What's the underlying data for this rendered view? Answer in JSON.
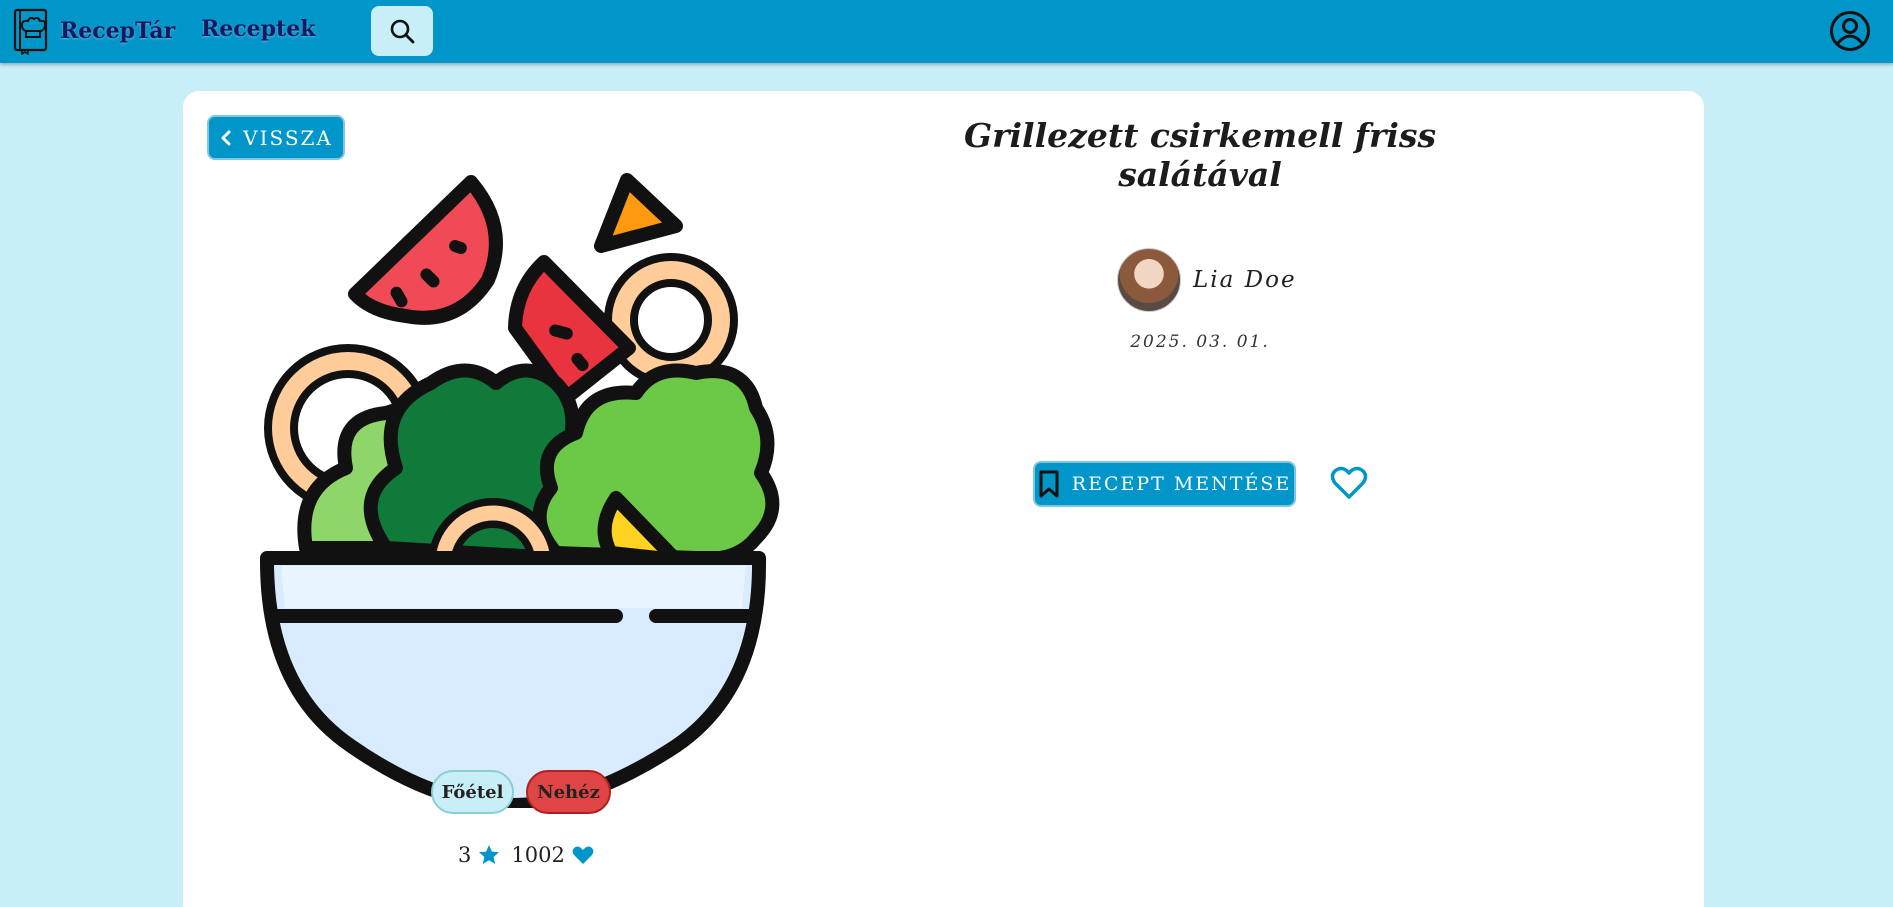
{
  "colors": {
    "navbar": "#0096c9",
    "background": "#c8eff7",
    "accent": "#0096c9",
    "brand_text": "#1a1760",
    "difficulty_hard": "#e04545"
  },
  "header": {
    "brand": "RecepTár",
    "brand_icon": "chef-book-icon",
    "nav": {
      "recipes_label": "Receptek"
    },
    "search_icon": "search-icon",
    "profile_icon": "user-circle-icon"
  },
  "recipe": {
    "back_label": "VISSZA",
    "title": "Grillezett csirkemell friss salátával",
    "image_icon": "salad-bowl-illustration",
    "author": {
      "name": "Lia Doe"
    },
    "date": "2025. 03. 01.",
    "save_label": "RECEPT MENTÉSE",
    "tags": {
      "course": "Főétel",
      "difficulty": "Nehéz"
    },
    "stats": {
      "rating": "3",
      "likes": "1002"
    }
  }
}
